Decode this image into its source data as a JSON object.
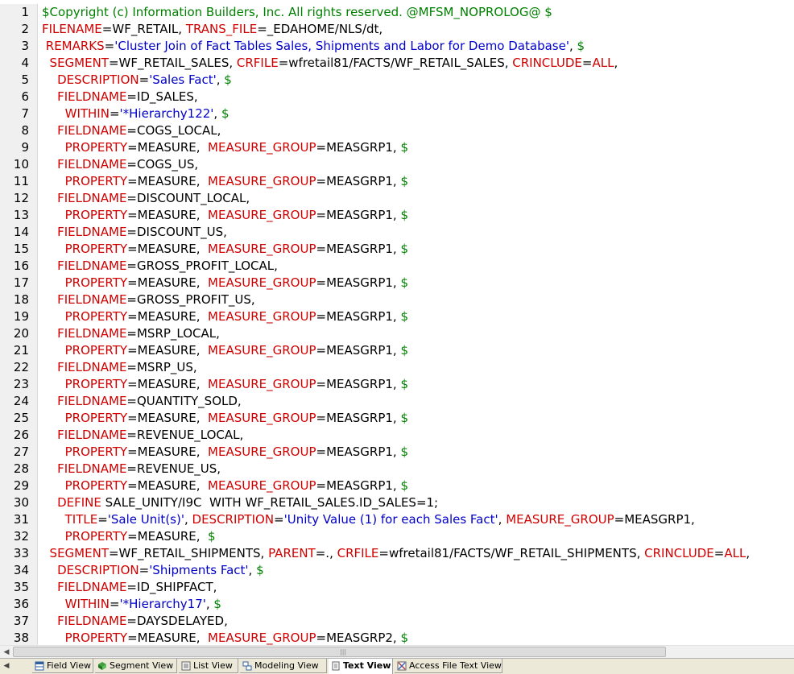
{
  "editor": {
    "lines": [
      {
        "n": "1",
        "indent": "",
        "parts": [
          [
            "g",
            "$Copyright (c) Information Builders, Inc. All rights reserved. @MFSM_NOPROLOG@ $"
          ]
        ]
      },
      {
        "n": "2",
        "indent": "",
        "parts": [
          [
            "k",
            "FILENAME"
          ],
          [
            "t",
            "=WF_RETAIL, "
          ],
          [
            "k",
            "TRANS_FILE"
          ],
          [
            "t",
            "=_EDAHOME/NLS/dt,"
          ]
        ]
      },
      {
        "n": "3",
        "indent": " ",
        "parts": [
          [
            "k",
            "REMARKS"
          ],
          [
            "t",
            "="
          ],
          [
            "s",
            "'Cluster Join of Fact Tables Sales, Shipments and Labor for Demo Database'"
          ],
          [
            "t",
            ", "
          ],
          [
            "g",
            "$"
          ]
        ]
      },
      {
        "n": "4",
        "indent": "  ",
        "parts": [
          [
            "k",
            "SEGMENT"
          ],
          [
            "t",
            "=WF_RETAIL_SALES, "
          ],
          [
            "k",
            "CRFILE"
          ],
          [
            "t",
            "=wfretail81/FACTS/WF_RETAIL_SALES, "
          ],
          [
            "k",
            "CRINCLUDE"
          ],
          [
            "t",
            "="
          ],
          [
            "k",
            "ALL"
          ],
          [
            "t",
            ","
          ]
        ]
      },
      {
        "n": "5",
        "indent": "    ",
        "parts": [
          [
            "k",
            "DESCRIPTION"
          ],
          [
            "t",
            "="
          ],
          [
            "s",
            "'Sales Fact'"
          ],
          [
            "t",
            ", "
          ],
          [
            "g",
            "$"
          ]
        ]
      },
      {
        "n": "6",
        "indent": "    ",
        "parts": [
          [
            "k",
            "FIELDNAME"
          ],
          [
            "t",
            "=ID_SALES,"
          ]
        ]
      },
      {
        "n": "7",
        "indent": "      ",
        "parts": [
          [
            "k",
            "WITHIN"
          ],
          [
            "t",
            "="
          ],
          [
            "s",
            "'*Hierarchy122'"
          ],
          [
            "t",
            ", "
          ],
          [
            "g",
            "$"
          ]
        ]
      },
      {
        "n": "8",
        "indent": "    ",
        "parts": [
          [
            "k",
            "FIELDNAME"
          ],
          [
            "t",
            "=COGS_LOCAL,"
          ]
        ]
      },
      {
        "n": "9",
        "indent": "      ",
        "parts": [
          [
            "k",
            "PROPERTY"
          ],
          [
            "t",
            "=MEASURE,  "
          ],
          [
            "k",
            "MEASURE_GROUP"
          ],
          [
            "t",
            "=MEASGRP1, "
          ],
          [
            "g",
            "$"
          ]
        ]
      },
      {
        "n": "10",
        "indent": "    ",
        "parts": [
          [
            "k",
            "FIELDNAME"
          ],
          [
            "t",
            "=COGS_US,"
          ]
        ]
      },
      {
        "n": "11",
        "indent": "      ",
        "parts": [
          [
            "k",
            "PROPERTY"
          ],
          [
            "t",
            "=MEASURE,  "
          ],
          [
            "k",
            "MEASURE_GROUP"
          ],
          [
            "t",
            "=MEASGRP1, "
          ],
          [
            "g",
            "$"
          ]
        ]
      },
      {
        "n": "12",
        "indent": "    ",
        "parts": [
          [
            "k",
            "FIELDNAME"
          ],
          [
            "t",
            "=DISCOUNT_LOCAL,"
          ]
        ]
      },
      {
        "n": "13",
        "indent": "      ",
        "parts": [
          [
            "k",
            "PROPERTY"
          ],
          [
            "t",
            "=MEASURE,  "
          ],
          [
            "k",
            "MEASURE_GROUP"
          ],
          [
            "t",
            "=MEASGRP1, "
          ],
          [
            "g",
            "$"
          ]
        ]
      },
      {
        "n": "14",
        "indent": "    ",
        "parts": [
          [
            "k",
            "FIELDNAME"
          ],
          [
            "t",
            "=DISCOUNT_US,"
          ]
        ]
      },
      {
        "n": "15",
        "indent": "      ",
        "parts": [
          [
            "k",
            "PROPERTY"
          ],
          [
            "t",
            "=MEASURE,  "
          ],
          [
            "k",
            "MEASURE_GROUP"
          ],
          [
            "t",
            "=MEASGRP1, "
          ],
          [
            "g",
            "$"
          ]
        ]
      },
      {
        "n": "16",
        "indent": "    ",
        "parts": [
          [
            "k",
            "FIELDNAME"
          ],
          [
            "t",
            "=GROSS_PROFIT_LOCAL,"
          ]
        ]
      },
      {
        "n": "17",
        "indent": "      ",
        "parts": [
          [
            "k",
            "PROPERTY"
          ],
          [
            "t",
            "=MEASURE,  "
          ],
          [
            "k",
            "MEASURE_GROUP"
          ],
          [
            "t",
            "=MEASGRP1, "
          ],
          [
            "g",
            "$"
          ]
        ]
      },
      {
        "n": "18",
        "indent": "    ",
        "parts": [
          [
            "k",
            "FIELDNAME"
          ],
          [
            "t",
            "=GROSS_PROFIT_US,"
          ]
        ]
      },
      {
        "n": "19",
        "indent": "      ",
        "parts": [
          [
            "k",
            "PROPERTY"
          ],
          [
            "t",
            "=MEASURE,  "
          ],
          [
            "k",
            "MEASURE_GROUP"
          ],
          [
            "t",
            "=MEASGRP1, "
          ],
          [
            "g",
            "$"
          ]
        ]
      },
      {
        "n": "20",
        "indent": "    ",
        "parts": [
          [
            "k",
            "FIELDNAME"
          ],
          [
            "t",
            "=MSRP_LOCAL,"
          ]
        ]
      },
      {
        "n": "21",
        "indent": "      ",
        "parts": [
          [
            "k",
            "PROPERTY"
          ],
          [
            "t",
            "=MEASURE,  "
          ],
          [
            "k",
            "MEASURE_GROUP"
          ],
          [
            "t",
            "=MEASGRP1, "
          ],
          [
            "g",
            "$"
          ]
        ]
      },
      {
        "n": "22",
        "indent": "    ",
        "parts": [
          [
            "k",
            "FIELDNAME"
          ],
          [
            "t",
            "=MSRP_US,"
          ]
        ]
      },
      {
        "n": "23",
        "indent": "      ",
        "parts": [
          [
            "k",
            "PROPERTY"
          ],
          [
            "t",
            "=MEASURE,  "
          ],
          [
            "k",
            "MEASURE_GROUP"
          ],
          [
            "t",
            "=MEASGRP1, "
          ],
          [
            "g",
            "$"
          ]
        ]
      },
      {
        "n": "24",
        "indent": "    ",
        "parts": [
          [
            "k",
            "FIELDNAME"
          ],
          [
            "t",
            "=QUANTITY_SOLD,"
          ]
        ]
      },
      {
        "n": "25",
        "indent": "      ",
        "parts": [
          [
            "k",
            "PROPERTY"
          ],
          [
            "t",
            "=MEASURE,  "
          ],
          [
            "k",
            "MEASURE_GROUP"
          ],
          [
            "t",
            "=MEASGRP1, "
          ],
          [
            "g",
            "$"
          ]
        ]
      },
      {
        "n": "26",
        "indent": "    ",
        "parts": [
          [
            "k",
            "FIELDNAME"
          ],
          [
            "t",
            "=REVENUE_LOCAL,"
          ]
        ]
      },
      {
        "n": "27",
        "indent": "      ",
        "parts": [
          [
            "k",
            "PROPERTY"
          ],
          [
            "t",
            "=MEASURE,  "
          ],
          [
            "k",
            "MEASURE_GROUP"
          ],
          [
            "t",
            "=MEASGRP1, "
          ],
          [
            "g",
            "$"
          ]
        ]
      },
      {
        "n": "28",
        "indent": "    ",
        "parts": [
          [
            "k",
            "FIELDNAME"
          ],
          [
            "t",
            "=REVENUE_US,"
          ]
        ]
      },
      {
        "n": "29",
        "indent": "      ",
        "parts": [
          [
            "k",
            "PROPERTY"
          ],
          [
            "t",
            "=MEASURE,  "
          ],
          [
            "k",
            "MEASURE_GROUP"
          ],
          [
            "t",
            "=MEASGRP1, "
          ],
          [
            "g",
            "$"
          ]
        ]
      },
      {
        "n": "30",
        "indent": "    ",
        "parts": [
          [
            "k",
            "DEFINE"
          ],
          [
            "t",
            " SALE_UNITY/I9C  WITH WF_RETAIL_SALES.ID_SALES=1;"
          ]
        ]
      },
      {
        "n": "31",
        "indent": "      ",
        "parts": [
          [
            "k",
            "TITLE"
          ],
          [
            "t",
            "="
          ],
          [
            "s",
            "'Sale Unit(s)'"
          ],
          [
            "t",
            ", "
          ],
          [
            "k",
            "DESCRIPTION"
          ],
          [
            "t",
            "="
          ],
          [
            "s",
            "'Unity Value (1) for each Sales Fact'"
          ],
          [
            "t",
            ", "
          ],
          [
            "k",
            "MEASURE_GROUP"
          ],
          [
            "t",
            "=MEASGRP1,"
          ]
        ]
      },
      {
        "n": "32",
        "indent": "      ",
        "parts": [
          [
            "k",
            "PROPERTY"
          ],
          [
            "t",
            "=MEASURE,  "
          ],
          [
            "g",
            "$"
          ]
        ]
      },
      {
        "n": "33",
        "indent": "  ",
        "parts": [
          [
            "k",
            "SEGMENT"
          ],
          [
            "t",
            "=WF_RETAIL_SHIPMENTS, "
          ],
          [
            "k",
            "PARENT"
          ],
          [
            "t",
            "=., "
          ],
          [
            "k",
            "CRFILE"
          ],
          [
            "t",
            "=wfretail81/FACTS/WF_RETAIL_SHIPMENTS, "
          ],
          [
            "k",
            "CRINCLUDE"
          ],
          [
            "t",
            "="
          ],
          [
            "k",
            "ALL"
          ],
          [
            "t",
            ","
          ]
        ]
      },
      {
        "n": "34",
        "indent": "    ",
        "parts": [
          [
            "k",
            "DESCRIPTION"
          ],
          [
            "t",
            "="
          ],
          [
            "s",
            "'Shipments Fact'"
          ],
          [
            "t",
            ", "
          ],
          [
            "g",
            "$"
          ]
        ]
      },
      {
        "n": "35",
        "indent": "    ",
        "parts": [
          [
            "k",
            "FIELDNAME"
          ],
          [
            "t",
            "=ID_SHIPFACT,"
          ]
        ]
      },
      {
        "n": "36",
        "indent": "      ",
        "parts": [
          [
            "k",
            "WITHIN"
          ],
          [
            "t",
            "="
          ],
          [
            "s",
            "'*Hierarchy17'"
          ],
          [
            "t",
            ", "
          ],
          [
            "g",
            "$"
          ]
        ]
      },
      {
        "n": "37",
        "indent": "    ",
        "parts": [
          [
            "k",
            "FIELDNAME"
          ],
          [
            "t",
            "=DAYSDELAYED,"
          ]
        ]
      },
      {
        "n": "38",
        "indent": "      ",
        "parts": [
          [
            "k",
            "PROPERTY"
          ],
          [
            "t",
            "=MEASURE,  "
          ],
          [
            "k",
            "MEASURE_GROUP"
          ],
          [
            "t",
            "=MEASGRP2, "
          ],
          [
            "g",
            "$"
          ]
        ]
      }
    ]
  },
  "colors": {
    "keyword": "#d00000",
    "string": "#0000c8",
    "comment_dollar": "#008000",
    "text": "#000000"
  },
  "tabs": [
    {
      "label": "Field View",
      "icon": "field-view-icon",
      "active": false
    },
    {
      "label": "Segment View",
      "icon": "segment-view-icon",
      "active": false
    },
    {
      "label": "List View",
      "icon": "list-view-icon",
      "active": false
    },
    {
      "label": "Modeling View",
      "icon": "modeling-view-icon",
      "active": false
    },
    {
      "label": "Text View",
      "icon": "text-view-icon",
      "active": true
    },
    {
      "label": "Access File Text View",
      "icon": "access-file-text-view-icon",
      "active": false
    }
  ],
  "scrollbar": {
    "left_arrow": "◀",
    "grip": "|||"
  }
}
